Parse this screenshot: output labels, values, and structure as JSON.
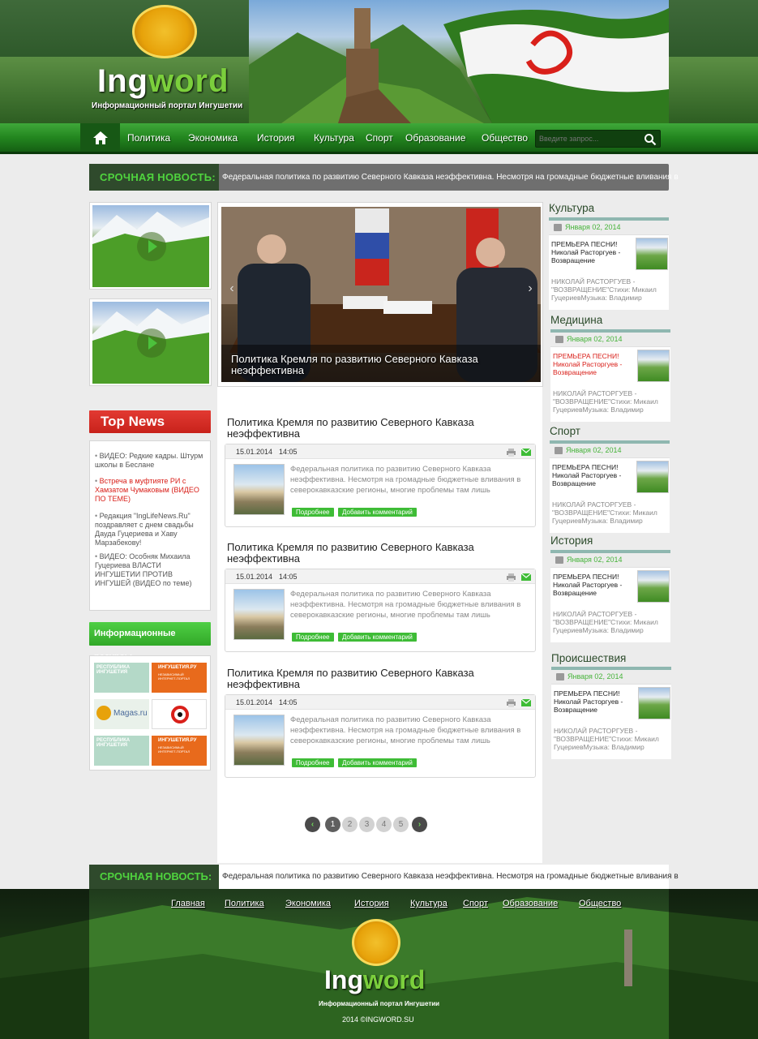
{
  "header": {
    "logo_main": "Ing",
    "logo_accent": "word",
    "subtitle": "Информационный  портал Ингушетии"
  },
  "nav": {
    "items": [
      "Политика",
      "Экономика",
      "История",
      "Культура",
      "Спорт",
      "Образование",
      "Общество"
    ],
    "search_placeholder": "Введите запрос..."
  },
  "breaking": {
    "label": "СРОЧНАЯ НОВОСТЬ:",
    "text": "Федеральная политика по развитию Северного Кавказа неэффективна. Несмотря на громадные бюджетные вливания в"
  },
  "top_news": {
    "title": "Top News",
    "items": [
      {
        "text": "ВИДЕО: Редкие кадры. Штурм школы в Беслане",
        "highlight": false
      },
      {
        "text": "Встреча в муфтияте РИ с Хамзатом Чумаковым (ВИДЕО ПО ТЕМЕ)",
        "highlight": true
      },
      {
        "text": "Редакция \"IngLifeNews.Ru\" поздравляет с днем свадьбы Дауда Гуцериева и Хаву Марзабекову!",
        "highlight": false
      },
      {
        "text": "ВИДЕО: Особняк Михаила Гуцериева ВЛАСТИ ИНГУШЕТИИ ПРОТИВ ИНГУШЕЙ (ВИДЕО по теме)",
        "highlight": false
      }
    ]
  },
  "resources": {
    "title": "Информационные ресурсы",
    "items": [
      "РЕСПУБЛИКА ИНГУШЕТИЯ",
      "ИНГУШЕТИЯ.РУ",
      "Magas.ru",
      "",
      "РЕСПУБЛИКА ИНГУШЕТИЯ",
      "ИНГУШЕТИЯ.РУ"
    ],
    "sub": "НЕЗАВИСИМЫЙ ИНТЕРНЕТ-ПОРТАЛ"
  },
  "slider": {
    "caption": "Политика Кремля по развитию Северного Кавказа неэффективна"
  },
  "articles": [
    {
      "title": "Политика Кремля по развитию Северного Кавказа неэффективна",
      "date": "15.01.2014",
      "time": "14:05",
      "excerpt": "Федеральная политика по развитию Северного Кавказа неэффективна. Несмотря на громадные бюджетные вливания в северокавказские регионы, многие проблемы там лишь",
      "more": "Подробнее",
      "comment": "Добавить комментарий"
    },
    {
      "title": "Политика Кремля по развитию Северного Кавказа неэффективна",
      "date": "15.01.2014",
      "time": "14:05",
      "excerpt": "Федеральная политика по развитию Северного Кавказа неэффективна. Несмотря на громадные бюджетные вливания в северокавказские регионы, многие проблемы там лишь",
      "more": "Подробнее",
      "comment": "Добавить комментарий"
    },
    {
      "title": "Политика Кремля по развитию Северного Кавказа неэффективна",
      "date": "15.01.2014",
      "time": "14:05",
      "excerpt": "Федеральная политика по развитию Северного Кавказа неэффективна. Несмотря на громадные бюджетные вливания в северокавказские регионы, многие проблемы там лишь",
      "more": "Подробнее",
      "comment": "Добавить комментарий"
    }
  ],
  "pagination": {
    "pages": [
      "1",
      "2",
      "3",
      "4",
      "5"
    ],
    "current": "1"
  },
  "sidebar": [
    {
      "title": "Культура",
      "date": "Января 02, 2014",
      "headline": "ПРЕМЬЕРА ПЕСНИ! Николай Расторгуев - Возвращение",
      "red": false,
      "excerpt": "НИКОЛАЙ РАСТОРГУЕВ - \"ВОЗВРАЩЕНИЕ\"Стихи: Микаил ГуцериевМузыка: Владимир"
    },
    {
      "title": "Медицина",
      "date": "Января 02, 2014",
      "headline": "ПРЕМЬЕРА ПЕСНИ! Николай Расторгуев - Возвращение",
      "red": true,
      "excerpt": "НИКОЛАЙ РАСТОРГУЕВ - \"ВОЗВРАЩЕНИЕ\"Стихи: Микаил ГуцериевМузыка: Владимир"
    },
    {
      "title": "Спорт",
      "date": "Января 02, 2014",
      "headline": "ПРЕМЬЕРА ПЕСНИ! Николай Расторгуев - Возвращение",
      "red": false,
      "excerpt": "НИКОЛАЙ РАСТОРГУЕВ - \"ВОЗВРАЩЕНИЕ\"Стихи: Микаил ГуцериевМузыка: Владимир"
    },
    {
      "title": "История",
      "date": "Января 02, 2014",
      "headline": "ПРЕМЬЕРА ПЕСНИ! Николай Расторгуев - Возвращение",
      "red": false,
      "excerpt": "НИКОЛАЙ РАСТОРГУЕВ - \"ВОЗВРАЩЕНИЕ\"Стихи: Микаил ГуцериевМузыка: Владимир"
    },
    {
      "title": "Происшествия",
      "date": "Января 02, 2014",
      "headline": "ПРЕМЬЕРА ПЕСНИ! Николай Расторгуев - Возвращение",
      "red": false,
      "excerpt": "НИКОЛАЙ РАСТОРГУЕВ - \"ВОЗВРАЩЕНИЕ\"Стихи: Микаил ГуцериевМузыка: Владимир"
    }
  ],
  "footer": {
    "nav": [
      "Главная",
      "Политика",
      "Экономика",
      "История",
      "Культура",
      "Спорт",
      "Образование",
      "Общество"
    ],
    "logo_main": "Ing",
    "logo_accent": "word",
    "subtitle": "Информационный  портал Ингушетии",
    "copyright": "2014 ©INGWORD.SU"
  },
  "colors": {
    "brand_green": "#23861f",
    "accent_green": "#3ebc36",
    "top_news_red": "#d9201a",
    "breaking_label": "#4fd43e"
  },
  "icons": [
    "home-icon",
    "search-icon",
    "print-icon",
    "mail-icon",
    "play-icon",
    "calendar-icon",
    "arrow-left-icon",
    "arrow-right-icon"
  ]
}
